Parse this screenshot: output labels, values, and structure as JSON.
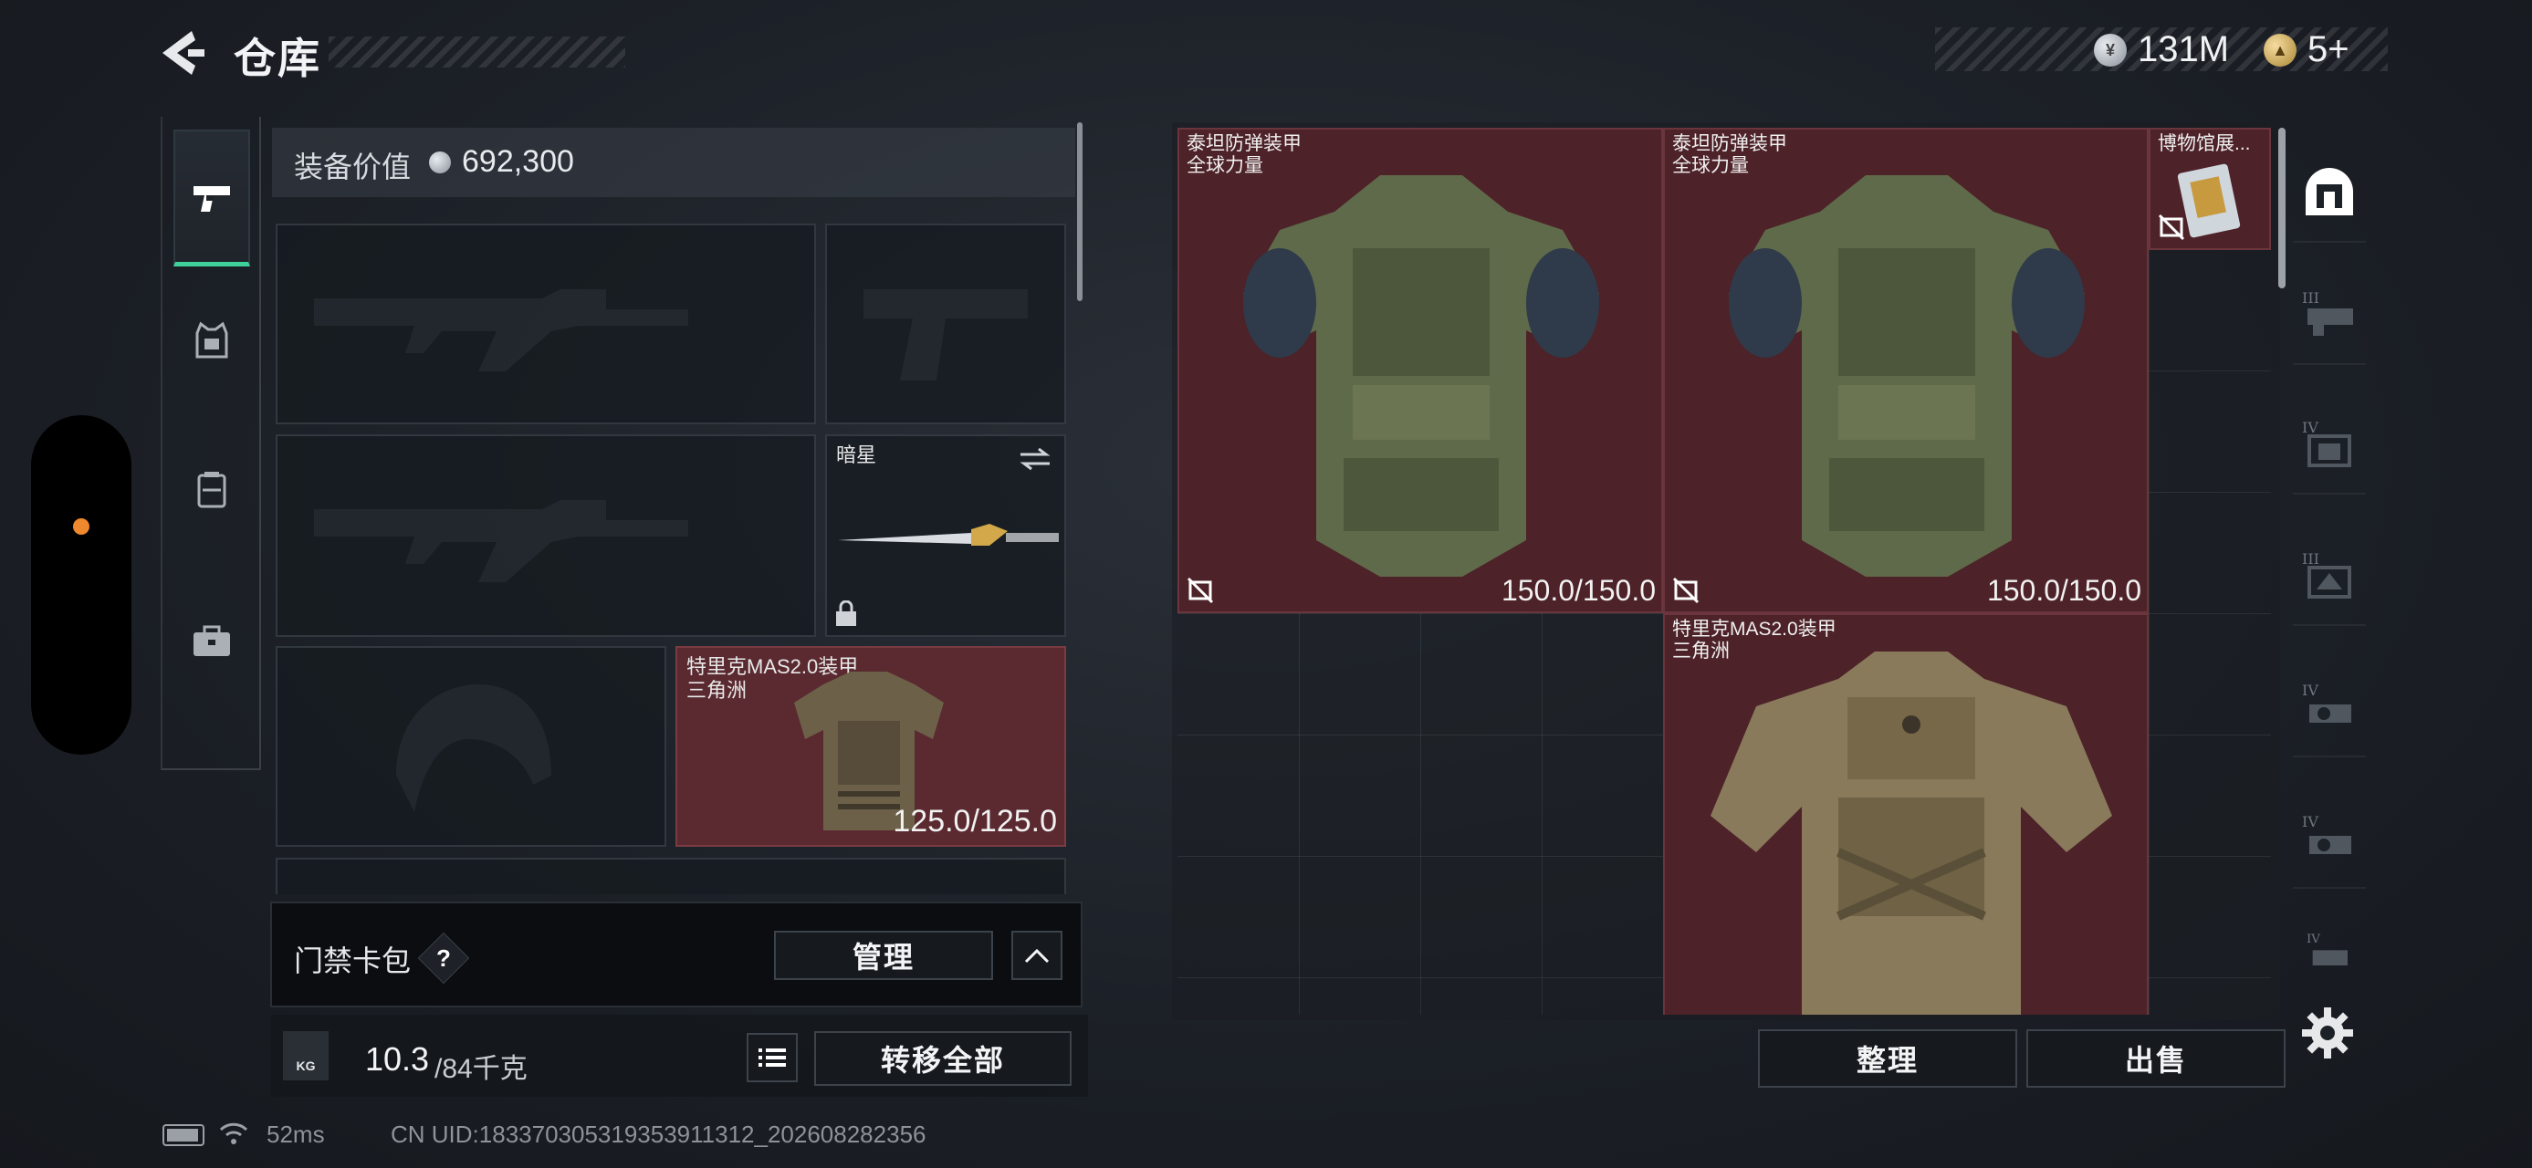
{
  "header": {
    "title": "仓库",
    "currency": {
      "money_value": "131M",
      "token_value": "5+"
    }
  },
  "categories": [
    "weapons",
    "helmet",
    "backpack",
    "case"
  ],
  "equipment": {
    "value_label": "装备价值",
    "value": "692,300",
    "slots": [
      {
        "name": "",
        "kind": "rifle-empty"
      },
      {
        "name": "",
        "kind": "pistol-empty"
      },
      {
        "name": "",
        "kind": "rifle-empty"
      },
      {
        "name": "暗星",
        "kind": "melee"
      },
      {
        "name": "",
        "kind": "helmet-empty"
      },
      {
        "name": "特里克MAS2.0装甲",
        "sub": "三角洲",
        "durability": "125.0/125.0",
        "kind": "armor"
      }
    ],
    "keycard": {
      "label": "门禁卡包",
      "help": "?",
      "manage_label": "管理"
    },
    "weight": {
      "current": "10.3",
      "max": "/84千克",
      "unit_icon": "KG"
    },
    "transfer_label": "转移全部"
  },
  "storage": {
    "items": [
      {
        "name": "泰坦防弹装甲",
        "sub": "全球力量",
        "durability": "150.0/150.0"
      },
      {
        "name": "泰坦防弹装甲",
        "sub": "全球力量",
        "durability": "150.0/150.0"
      },
      {
        "name": "博物馆展...",
        "sub": ""
      },
      {
        "name": "特里克MAS2.0装甲",
        "sub": "三角洲"
      }
    ],
    "sort_label": "整理",
    "sell_label": "出售"
  },
  "filters": [
    {
      "icon": "vault-icon",
      "tier": ""
    },
    {
      "icon": "rig-tier-icon",
      "tier": "III"
    },
    {
      "icon": "armor-tier-icon",
      "tier": "IV"
    },
    {
      "icon": "armor-tier-icon",
      "tier": "III"
    },
    {
      "icon": "gear-tier-icon",
      "tier": "IV"
    },
    {
      "icon": "gear-tier-icon",
      "tier": "IV"
    },
    {
      "icon": "gear-tier-icon",
      "tier": "IV"
    }
  ],
  "status": {
    "ping": "52ms",
    "uid": "CN UID:183370305319353911312_202608282356"
  },
  "colors": {
    "accent_green": "#3ed19a",
    "item_bg": "#4d2228",
    "handle_dot": "#f0892e"
  }
}
